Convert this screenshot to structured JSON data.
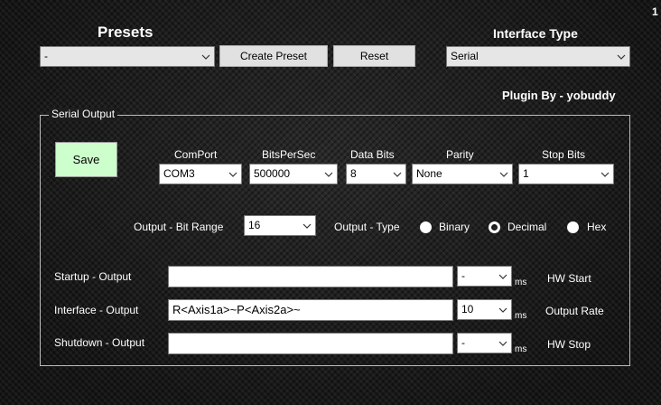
{
  "corner_number": "1",
  "presets": {
    "heading": "Presets",
    "selected": "-",
    "create_label": "Create Preset",
    "reset_label": "Reset"
  },
  "interface_type": {
    "heading": "Interface Type",
    "selected": "Serial"
  },
  "plugin_credit": "Plugin By - yobuddy",
  "serial_output": {
    "group_title": "Serial Output",
    "save_label": "Save",
    "save_color": "#ccffcc",
    "comport": {
      "label": "ComPort",
      "value": "COM3"
    },
    "bits_per_sec": {
      "label": "BitsPerSec",
      "value": "500000"
    },
    "data_bits": {
      "label": "Data Bits",
      "value": "8"
    },
    "parity": {
      "label": "Parity",
      "value": "None"
    },
    "stop_bits": {
      "label": "Stop Bits",
      "value": "1"
    },
    "bit_range": {
      "label": "Output - Bit Range",
      "value": "16"
    },
    "output_type": {
      "label": "Output - Type",
      "options": [
        "Binary",
        "Decimal",
        "Hex"
      ],
      "selected": "Decimal"
    },
    "rows": {
      "startup": {
        "label": "Startup - Output",
        "text": "",
        "ms_value": "-",
        "unit": "ms",
        "right_label": "HW Start"
      },
      "interface": {
        "label": "Interface - Output",
        "text": "R<Axis1a>~P<Axis2a>~",
        "ms_value": "10",
        "unit": "ms",
        "right_label": "Output Rate"
      },
      "shutdown": {
        "label": "Shutdown - Output",
        "text": "",
        "ms_value": "-",
        "unit": "ms",
        "right_label": "HW Stop"
      }
    }
  }
}
